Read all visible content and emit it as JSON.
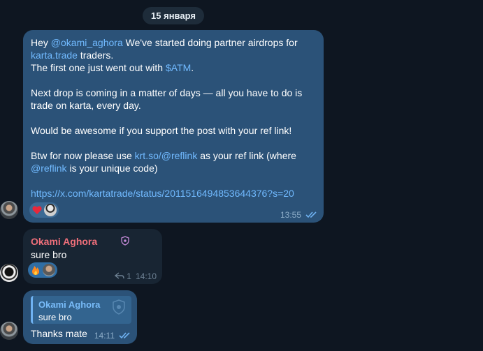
{
  "date_divider": "15 января",
  "messages": [
    {
      "paragraphs": [
        {
          "pre": "Hey ",
          "mention": "@okami_aghora",
          "mid": " We've started doing partner airdrops for ",
          "link": "karta.trade",
          "post": " traders."
        },
        {
          "pre": "The first one just went out with ",
          "link": "$ATM",
          "post": "."
        }
      ],
      "p2": "Next drop is coming in a matter of days — all you have to do is trade on karta, every day.",
      "p3": "Would be awesome if you support the post with your ref link!",
      "p4": {
        "pre": "Btw for now please use ",
        "link": "krt.so/@reflink",
        "mid": " as your ref link (where ",
        "mention": "@reflink",
        "post": " is your unique code)"
      },
      "url": "https://x.com/kartatrade/status/2011516494853644376?s=20",
      "reactions": [
        "heart",
        "user-avatar"
      ],
      "time": "13:55",
      "status": "read"
    },
    {
      "sender": "Okami Aghora",
      "text": "sure bro",
      "reactions": [
        "fire",
        "user-avatar"
      ],
      "replies": "1",
      "time": "14:10"
    },
    {
      "quote_name": "Okami Aghora",
      "quote_text": "sure bro",
      "text": "Thanks mate",
      "time": "14:11",
      "status": "read"
    }
  ],
  "colors": {
    "background": "#0e1621",
    "outgoing_bubble": "#2b5278",
    "incoming_bubble": "#182533",
    "link": "#71baff",
    "sender_name": "#ee6f7a"
  }
}
